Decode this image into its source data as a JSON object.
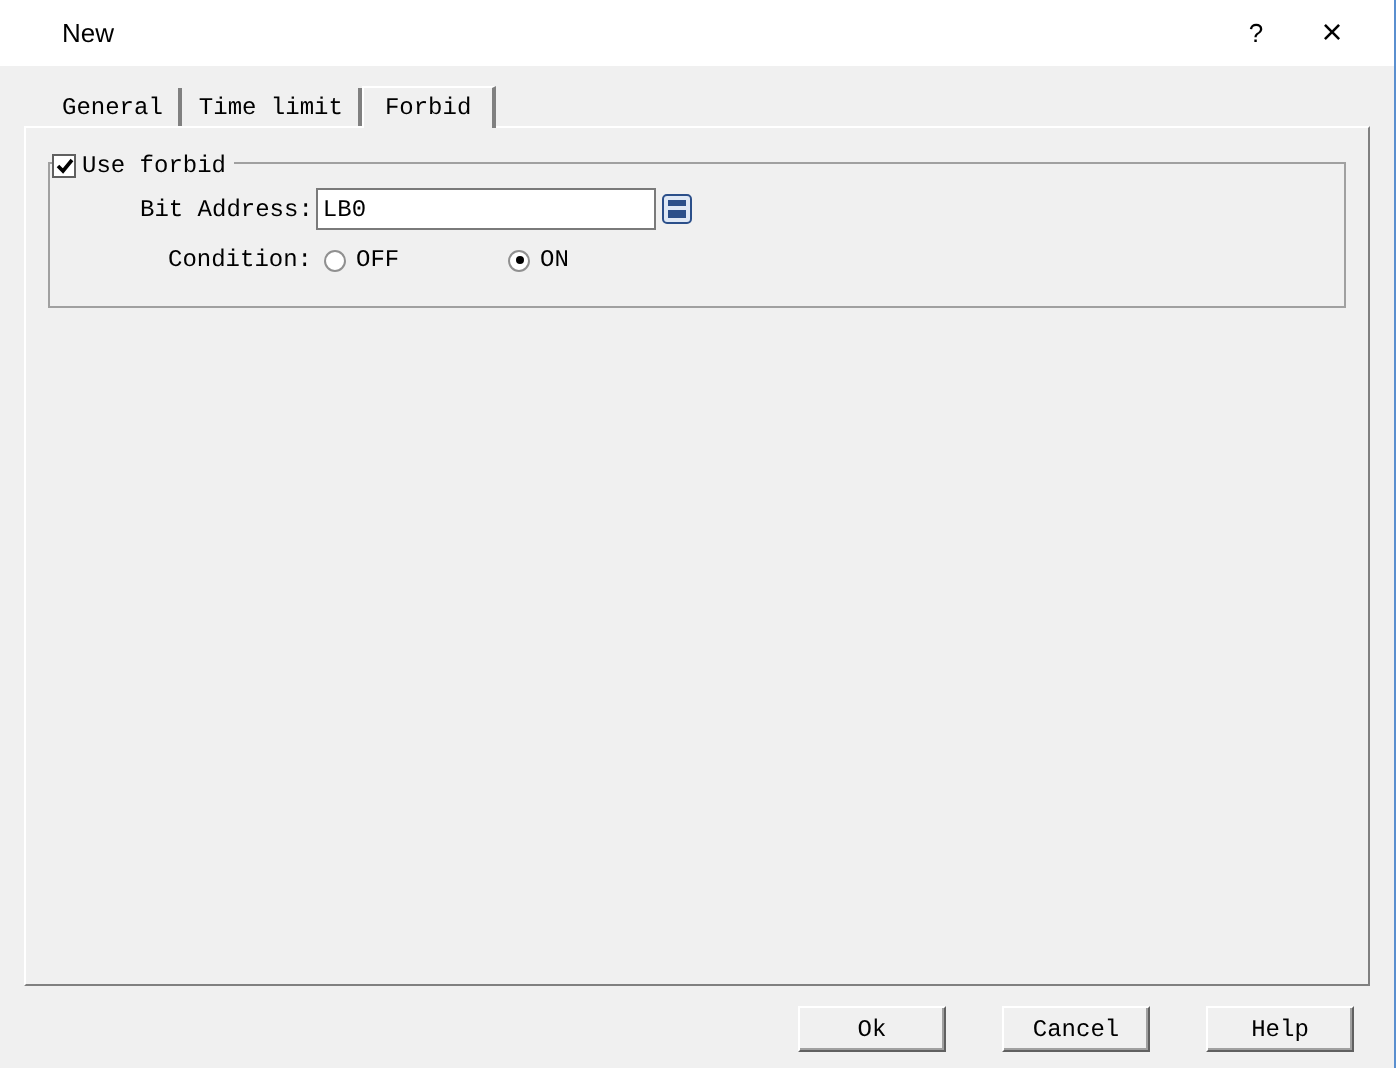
{
  "window": {
    "title": "New",
    "help": "?",
    "close": "×"
  },
  "tabs": [
    {
      "label": "General",
      "selected": false
    },
    {
      "label": "Time limit",
      "selected": false
    },
    {
      "label": "Forbid",
      "selected": true
    }
  ],
  "group": {
    "label": "Use forbid",
    "checked": true,
    "bit_address": {
      "label": "Bit Address:",
      "value": "LB0"
    },
    "condition": {
      "label": "Condition:",
      "options": [
        {
          "label": "OFF",
          "selected": false
        },
        {
          "label": "ON",
          "selected": true
        }
      ]
    }
  },
  "buttons": [
    "Ok",
    "Cancel",
    "Help"
  ]
}
